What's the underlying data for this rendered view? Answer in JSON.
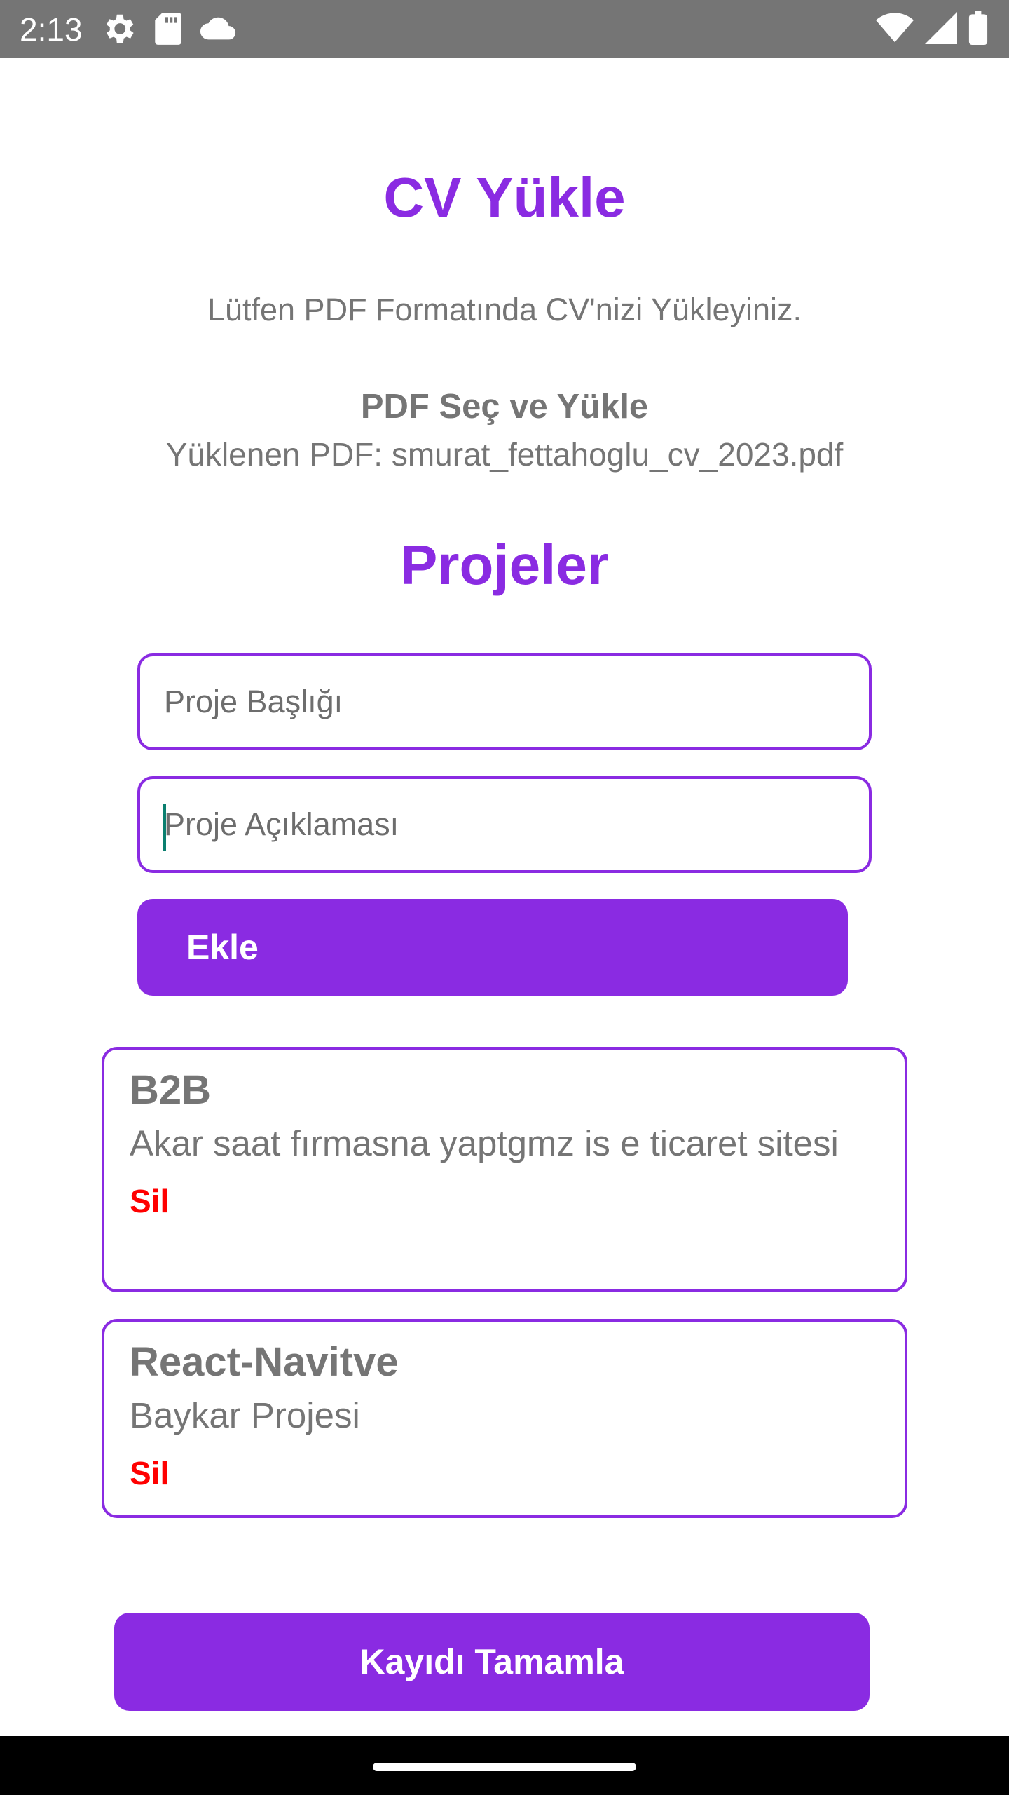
{
  "status_bar": {
    "time": "2:13",
    "left_icons": [
      "settings-icon",
      "sd-card-icon",
      "cloud-icon"
    ],
    "right_icons": [
      "wifi-icon",
      "signal-icon",
      "battery-icon"
    ]
  },
  "cv_section": {
    "title": "CV Yükle",
    "subtitle": "Lütfen PDF Formatında CV'nizi Yükleyiniz.",
    "select_label": "PDF Seç ve Yükle",
    "uploaded_text": "Yüklenen PDF: smurat_fettahoglu_cv_2023.pdf"
  },
  "projects_section": {
    "title": "Projeler",
    "title_input": {
      "placeholder": "Proje Başlığı",
      "value": ""
    },
    "description_input": {
      "placeholder": "Proje Açıklaması",
      "value": ""
    },
    "add_button": "Ekle",
    "items": [
      {
        "title": "B2B",
        "description": "Akar saat fırmasna yaptgmz is e ticaret sitesi",
        "delete_label": "Sil"
      },
      {
        "title": "React-Navitve",
        "description": "Baykar Projesi",
        "delete_label": "Sil"
      }
    ]
  },
  "complete_button": "Kayıdı Tamamla",
  "colors": {
    "accent": "#8a2be2",
    "text_gray": "#757575",
    "danger": "#ff0000",
    "status_bar": "#757575"
  }
}
